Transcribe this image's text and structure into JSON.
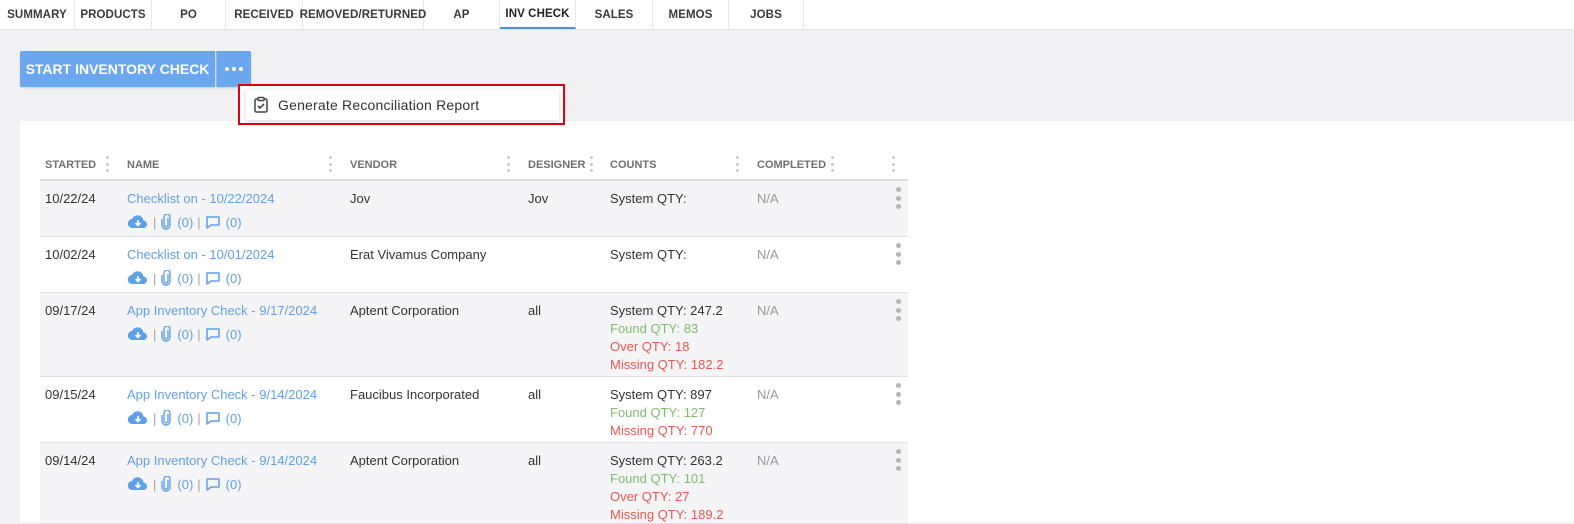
{
  "tabs": [
    {
      "label": "SUMMARY"
    },
    {
      "label": "PRODUCTS"
    },
    {
      "label": "PO"
    },
    {
      "label": "RECEIVED"
    },
    {
      "label": "REMOVED/RETURNED"
    },
    {
      "label": "AP"
    },
    {
      "label": "INV CHECK"
    },
    {
      "label": "SALES"
    },
    {
      "label": "MEMOS"
    },
    {
      "label": "JOBS"
    }
  ],
  "active_tab": "INV CHECK",
  "start_button": {
    "label": "START INVENTORY CHECK",
    "more_icon": "more-horizontal-icon"
  },
  "dropdown": {
    "items": [
      {
        "label": "Generate Reconciliation Report",
        "icon": "clipboard-check-icon"
      }
    ]
  },
  "table": {
    "columns": [
      "STARTED",
      "NAME",
      "VENDOR",
      "DESIGNER",
      "COUNTS",
      "COMPLETED"
    ],
    "rows": [
      {
        "started": "10/22/24",
        "name": "Checklist on - 10/22/2024",
        "vendor": "Jov",
        "designer": "Jov",
        "system": "System QTY:",
        "found": "",
        "over": "",
        "missing": "",
        "completed": "N/A",
        "attach_count": "(0)",
        "comment_count": "(0)"
      },
      {
        "started": "10/02/24",
        "name": "Checklist on - 10/01/2024",
        "vendor": "Erat Vivamus Company",
        "designer": "",
        "system": "System QTY:",
        "found": "",
        "over": "",
        "missing": "",
        "completed": "N/A",
        "attach_count": "(0)",
        "comment_count": "(0)"
      },
      {
        "started": "09/17/24",
        "name": "App Inventory Check - 9/17/2024",
        "vendor": "Aptent Corporation",
        "designer": "all",
        "system": "System QTY: 247.2",
        "found": "Found QTY: 83",
        "over": "Over QTY: 18",
        "missing": "Missing QTY: 182.2",
        "completed": "N/A",
        "attach_count": "(0)",
        "comment_count": "(0)"
      },
      {
        "started": "09/15/24",
        "name": "App Inventory Check - 9/14/2024",
        "vendor": "Faucibus Incorporated",
        "designer": "all",
        "system": "System QTY: 897",
        "found": "Found QTY: 127",
        "over": "",
        "missing": "Missing QTY: 770",
        "completed": "N/A",
        "attach_count": "(0)",
        "comment_count": "(0)"
      },
      {
        "started": "09/14/24",
        "name": "App Inventory Check - 9/14/2024",
        "vendor": "Aptent Corporation",
        "designer": "all",
        "system": "System QTY: 263.2",
        "found": "Found QTY: 101",
        "over": "Over QTY: 27",
        "missing": "Missing QTY: 189.2",
        "completed": "N/A",
        "attach_count": "(0)",
        "comment_count": "(0)"
      }
    ]
  },
  "colors": {
    "accent": "#6aa7ee",
    "link": "#5fa0e8",
    "found": "#7cbf6a",
    "missing": "#e8584f",
    "highlight_border": "#e00010"
  }
}
